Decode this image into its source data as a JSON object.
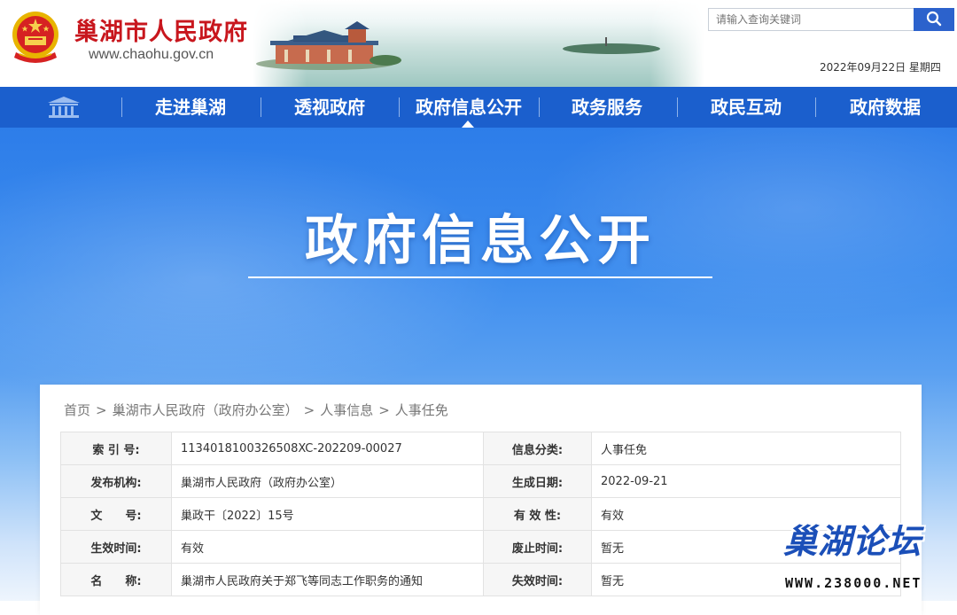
{
  "header": {
    "site_name": "巢湖市人民政府",
    "site_url": "www.chaohu.gov.cn",
    "search_placeholder": "请输入查询关键词",
    "date": "2022年09月22日 星期四"
  },
  "nav": {
    "items": [
      {
        "label": "走进巢湖"
      },
      {
        "label": "透视政府"
      },
      {
        "label": "政府信息公开",
        "active": true
      },
      {
        "label": "政务服务"
      },
      {
        "label": "政民互动"
      },
      {
        "label": "政府数据"
      }
    ]
  },
  "banner": {
    "title": "政府信息公开"
  },
  "breadcrumb": {
    "items": [
      "首页",
      "巢湖市人民政府（政府办公室）",
      "人事信息",
      "人事任免"
    ],
    "separator": ">"
  },
  "meta": {
    "rows": [
      {
        "l1": "索 引 号:",
        "v1": "1134018100326508XC-202209-00027",
        "l2": "信息分类:",
        "v2": "人事任免"
      },
      {
        "l1": "发布机构:",
        "v1": "巢湖市人民政府（政府办公室）",
        "l2": "生成日期:",
        "v2": "2022-09-21"
      },
      {
        "l1": "文　　号:",
        "v1": "巢政干〔2022〕15号",
        "l2": "有 效 性:",
        "v2": "有效"
      },
      {
        "l1": "生效时间:",
        "v1": "有效",
        "l2": "废止时间:",
        "v2": "暂无"
      },
      {
        "l1": "名　　称:",
        "v1": "巢湖市人民政府关于郑飞等同志工作职务的通知",
        "l2": "失效时间:",
        "v2": "暂无"
      }
    ]
  },
  "watermark": {
    "logo": "巢湖论坛",
    "url": "WWW.238000.NET"
  },
  "colors": {
    "brand_red": "#c8161d",
    "nav_blue": "#1b5fcd",
    "search_blue": "#2c62cc"
  },
  "icons": [
    "national-emblem-icon",
    "search-icon",
    "home-building-icon"
  ]
}
